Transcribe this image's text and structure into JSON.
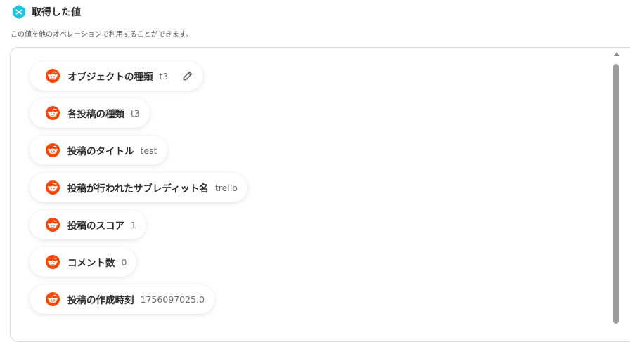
{
  "header": {
    "title": "取得した値",
    "subtitle": "この値を他のオペレーションで利用することができます。"
  },
  "colors": {
    "accent": "#1ec5e0",
    "reddit_orange": "#ff4500"
  },
  "icons": {
    "app": "app-logo-icon",
    "item": "reddit-icon",
    "edit": "pencil-icon"
  },
  "items": [
    {
      "label": "オブジェクトの種類",
      "value": "t3",
      "editable": true
    },
    {
      "label": "各投稿の種類",
      "value": "t3"
    },
    {
      "label": "投稿のタイトル",
      "value": "test"
    },
    {
      "label": "投稿が行われたサブレディット名",
      "value": "trello"
    },
    {
      "label": "投稿のスコア",
      "value": "1"
    },
    {
      "label": "コメント数",
      "value": "0"
    },
    {
      "label": "投稿の作成時刻",
      "value": "1756097025.0"
    }
  ]
}
